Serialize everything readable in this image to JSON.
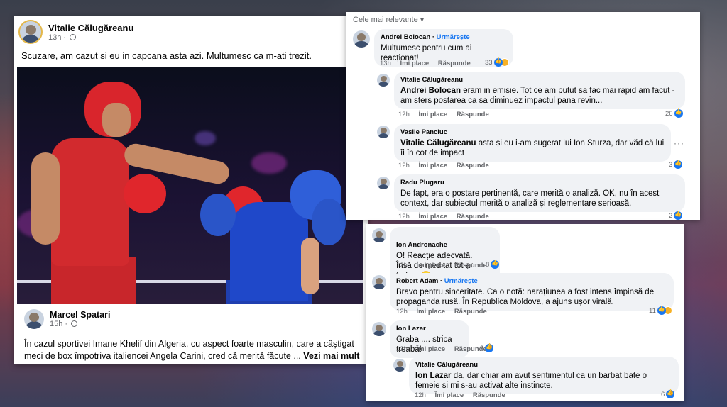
{
  "post1": {
    "author": "Vitalie Călugăreanu",
    "time": "13h",
    "text": "Scuzare, am cazut si eu in capcana asta azi. Multumesc ca m-ati trezit."
  },
  "post2": {
    "author": "Marcel Spatari",
    "time": "15h",
    "text": "În cazul sportivei Imane Khelif din Algeria, cu aspect foarte masculin, care a câștigat meci de box împotriva italiencei Angela Carini, cred că merită făcute ...",
    "see_more": "Vezi mai mult"
  },
  "comments1": {
    "sort_label": "Cele mai relevante",
    "items": [
      {
        "name": "Andrei Bolocan",
        "follow": "Urmărește",
        "text": "Mulțumesc pentru cum ai reacționat!",
        "time": "13h",
        "like": "Îmi place",
        "reply": "Răspunde",
        "count": "33"
      },
      {
        "name": "Vitalie Călugăreanu",
        "mention": "Andrei Bolocan",
        "text": "eram in emisie. Tot ce am putut sa fac mai rapid am facut - am sters postarea ca sa diminuez impactul pana revin...",
        "time": "12h",
        "like": "Îmi place",
        "reply": "Răspunde",
        "count": "26"
      },
      {
        "name": "Vasile Panciuc",
        "mention": "Vitalie Călugăreanu",
        "text": "asta și eu i-am sugerat lui Ion Sturza, dar văd că lui îi în cot de impact",
        "time": "12h",
        "like": "Îmi place",
        "reply": "Răspunde",
        "count": "3"
      },
      {
        "name": "Radu Plugaru",
        "text": "De fapt, era o postare pertinentă, care merită o analiză. OK, nu în acest context, dar subiectul merită o analiză și reglementare serioasă.",
        "time": "12h",
        "like": "Îmi place",
        "reply": "Răspunde",
        "count": "2"
      }
    ]
  },
  "comments2": {
    "items": [
      {
        "name": "Ion Andronache",
        "text": "O! Reacție adecvată.\nÎnsă de meditat tot ar trebui. 😀",
        "time": "12h",
        "like": "Îmi place",
        "reply": "Răspunde",
        "count": "8"
      },
      {
        "name": "Robert Adam",
        "follow": "Urmărește",
        "text": "Bravo pentru sinceritate. Ca o notă: narațiunea a fost intens împinsă de propaganda rusă. În Republica Moldova, a ajuns ușor virală.",
        "time": "12h",
        "like": "Îmi place",
        "reply": "Răspunde",
        "count": "11"
      },
      {
        "name": "Ion Lazar",
        "text": "Graba .... strica treaba!",
        "time": "12h",
        "like": "Îmi place",
        "reply": "Răspunde",
        "count": "2"
      },
      {
        "name": "Vitalie Călugăreanu",
        "mention": "Ion Lazar",
        "text": "da, dar chiar am avut sentimentul ca un barbat bate o femeie si mi s-au activat alte instincte.",
        "time": "12h",
        "like": "Îmi place",
        "reply": "Răspunde",
        "count": "6"
      }
    ]
  },
  "colors": {
    "accent": "#1877f2",
    "bubble": "#f0f2f5",
    "meta": "#65676b"
  }
}
